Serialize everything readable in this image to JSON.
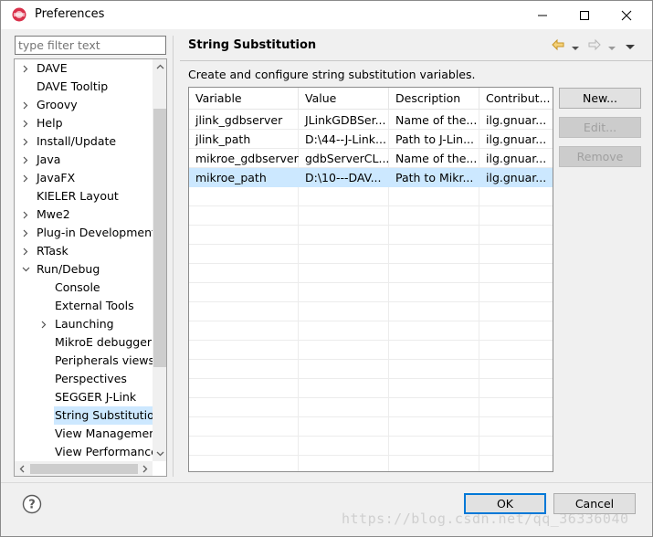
{
  "window": {
    "title": "Preferences"
  },
  "filter": {
    "placeholder": "type filter text"
  },
  "tree": {
    "items": [
      {
        "label": "DAVE",
        "level": 0,
        "expander": "collapsed"
      },
      {
        "label": "DAVE Tooltip",
        "level": 0,
        "expander": "none"
      },
      {
        "label": "Groovy",
        "level": 0,
        "expander": "collapsed"
      },
      {
        "label": "Help",
        "level": 0,
        "expander": "collapsed"
      },
      {
        "label": "Install/Update",
        "level": 0,
        "expander": "collapsed"
      },
      {
        "label": "Java",
        "level": 0,
        "expander": "collapsed"
      },
      {
        "label": "JavaFX",
        "level": 0,
        "expander": "collapsed"
      },
      {
        "label": "KIELER Layout",
        "level": 0,
        "expander": "none"
      },
      {
        "label": "Mwe2",
        "level": 0,
        "expander": "collapsed"
      },
      {
        "label": "Plug-in Development",
        "level": 0,
        "expander": "collapsed"
      },
      {
        "label": "RTask",
        "level": 0,
        "expander": "collapsed"
      },
      {
        "label": "Run/Debug",
        "level": 0,
        "expander": "expanded"
      },
      {
        "label": "Console",
        "level": 1,
        "expander": "none"
      },
      {
        "label": "External Tools",
        "level": 1,
        "expander": "none"
      },
      {
        "label": "Launching",
        "level": 1,
        "expander": "collapsed"
      },
      {
        "label": "MikroE debugger",
        "level": 1,
        "expander": "none"
      },
      {
        "label": "Peripherals views",
        "level": 1,
        "expander": "none"
      },
      {
        "label": "Perspectives",
        "level": 1,
        "expander": "none"
      },
      {
        "label": "SEGGER J-Link",
        "level": 1,
        "expander": "none"
      },
      {
        "label": "String Substitution",
        "level": 1,
        "expander": "none",
        "selected": true
      },
      {
        "label": "View Management",
        "level": 1,
        "expander": "none"
      },
      {
        "label": "View Performance",
        "level": 1,
        "expander": "none"
      }
    ]
  },
  "page": {
    "title": "String Substitution",
    "description": "Create and configure string substitution variables."
  },
  "table": {
    "columns": [
      "Variable",
      "Value",
      "Description",
      "Contribut..."
    ],
    "rows": [
      [
        "jlink_gdbserver",
        "JLinkGDBSer...",
        "Name of the...",
        "ilg.gnuar..."
      ],
      [
        "jlink_path",
        "D:\\44--J-Link...",
        "Path to J-Lin...",
        "ilg.gnuar..."
      ],
      [
        "mikroe_gdbserver",
        "gdbServerCL...",
        "Name of the...",
        "ilg.gnuar..."
      ],
      [
        "mikroe_path",
        "D:\\10---DAV...",
        "Path to Mikr...",
        "ilg.gnuar..."
      ]
    ],
    "selected_row": 3
  },
  "buttons": {
    "new": "New...",
    "edit": "Edit...",
    "remove": "Remove",
    "ok": "OK",
    "cancel": "Cancel"
  },
  "watermark": "https://blog.csdn.net/qq_36336040",
  "colors": {
    "selection": "#cce8ff",
    "default_button_border": "#0078d7"
  }
}
